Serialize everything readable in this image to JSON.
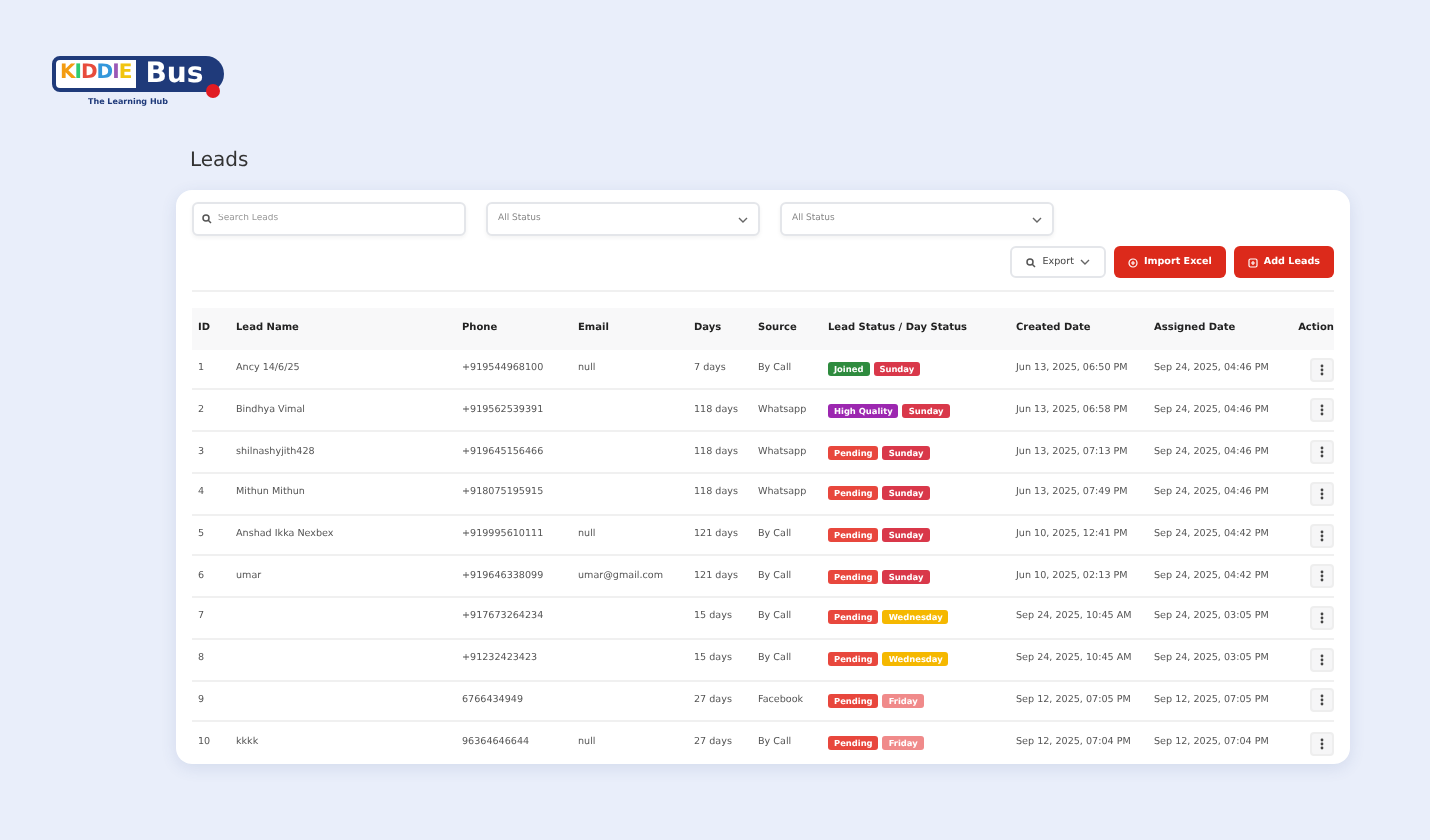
{
  "logo": {
    "word_1": "KIDDIE",
    "word_2": "Bus",
    "tagline": "The Learning Hub"
  },
  "page_title": "Leads",
  "search": {
    "placeholder": "Search Leads"
  },
  "filters": [
    {
      "value": "All Status"
    },
    {
      "value": "All Status"
    }
  ],
  "buttons": [
    {
      "kind": "export",
      "label": "Export"
    },
    {
      "kind": "import",
      "label": "Import Excel"
    },
    {
      "kind": "add",
      "label": "Add Leads"
    }
  ],
  "table": {
    "columns": [
      "ID",
      "Lead Name",
      "Phone",
      "Email",
      "Days",
      "Source",
      "Lead Status / Day Status",
      "Created Date",
      "Assigned Date",
      "Action"
    ],
    "rows": [
      {
        "id": "1",
        "name": "Ancy 14/6/25",
        "phone": "+919544968100",
        "email": "null",
        "days": "7 days",
        "source": "By Call",
        "status": {
          "label": "Joined",
          "color": "#2e8b3e"
        },
        "day": {
          "label": "Sunday",
          "color": "#d9384a"
        },
        "created": "Jun 13, 2025, 06:50 PM",
        "assigned": "Sep 24, 2025, 04:46 PM"
      },
      {
        "id": "2",
        "name": "Bindhya Vimal",
        "phone": "+919562539391",
        "email": "",
        "days": "118 days",
        "source": "Whatsapp",
        "status": {
          "label": "High Quality",
          "color": "#9c27b0"
        },
        "day": {
          "label": "Sunday",
          "color": "#d9384a"
        },
        "created": "Jun 13, 2025, 06:58 PM",
        "assigned": "Sep 24, 2025, 04:46 PM"
      },
      {
        "id": "3",
        "name": "shilnashyjith428",
        "phone": "+919645156466",
        "email": "",
        "days": "118 days",
        "source": "Whatsapp",
        "status": {
          "label": "Pending",
          "color": "#e8473d"
        },
        "day": {
          "label": "Sunday",
          "color": "#d9384a"
        },
        "created": "Jun 13, 2025, 07:13 PM",
        "assigned": "Sep 24, 2025, 04:46 PM"
      },
      {
        "id": "4",
        "name": "Mithun Mithun",
        "phone": "+918075195915",
        "email": "",
        "days": "118 days",
        "source": "Whatsapp",
        "status": {
          "label": "Pending",
          "color": "#e8473d"
        },
        "day": {
          "label": "Sunday",
          "color": "#d9384a"
        },
        "created": "Jun 13, 2025, 07:49 PM",
        "assigned": "Sep 24, 2025, 04:46 PM"
      },
      {
        "id": "5",
        "name": "Anshad Ikka Nexbex",
        "phone": "+919995610111",
        "email": "null",
        "days": "121 days",
        "source": "By Call",
        "status": {
          "label": "Pending",
          "color": "#e8473d"
        },
        "day": {
          "label": "Sunday",
          "color": "#d9384a"
        },
        "created": "Jun 10, 2025, 12:41 PM",
        "assigned": "Sep 24, 2025, 04:42 PM"
      },
      {
        "id": "6",
        "name": "umar",
        "phone": "+919646338099",
        "email": "umar@gmail.com",
        "days": "121 days",
        "source": "By Call",
        "status": {
          "label": "Pending",
          "color": "#e8473d"
        },
        "day": {
          "label": "Sunday",
          "color": "#d9384a"
        },
        "created": "Jun 10, 2025, 02:13 PM",
        "assigned": "Sep 24, 2025, 04:42 PM"
      },
      {
        "id": "7",
        "name": "",
        "phone": "+917673264234",
        "email": "",
        "days": "15 days",
        "source": "By Call",
        "status": {
          "label": "Pending",
          "color": "#e8473d"
        },
        "day": {
          "label": "Wednesday",
          "color": "#f5b800"
        },
        "created": "Sep 24, 2025, 10:45 AM",
        "assigned": "Sep 24, 2025, 03:05 PM"
      },
      {
        "id": "8",
        "name": "",
        "phone": "+91232423423",
        "email": "",
        "days": "15 days",
        "source": "By Call",
        "status": {
          "label": "Pending",
          "color": "#e8473d"
        },
        "day": {
          "label": "Wednesday",
          "color": "#f5b800"
        },
        "created": "Sep 24, 2025, 10:45 AM",
        "assigned": "Sep 24, 2025, 03:05 PM"
      },
      {
        "id": "9",
        "name": "",
        "phone": "6766434949",
        "email": "",
        "days": "27 days",
        "source": "Facebook",
        "status": {
          "label": "Pending",
          "color": "#e8473d"
        },
        "day": {
          "label": "Friday",
          "color": "#f08a8a"
        },
        "created": "Sep 12, 2025, 07:05 PM",
        "assigned": "Sep 12, 2025, 07:05 PM"
      },
      {
        "id": "10",
        "name": "kkkk",
        "phone": "96364646644",
        "email": "null",
        "days": "27 days",
        "source": "By Call",
        "status": {
          "label": "Pending",
          "color": "#e8473d"
        },
        "day": {
          "label": "Friday",
          "color": "#f08a8a"
        },
        "created": "Sep 12, 2025, 07:04 PM",
        "assigned": "Sep 12, 2025, 07:04 PM"
      }
    ]
  }
}
